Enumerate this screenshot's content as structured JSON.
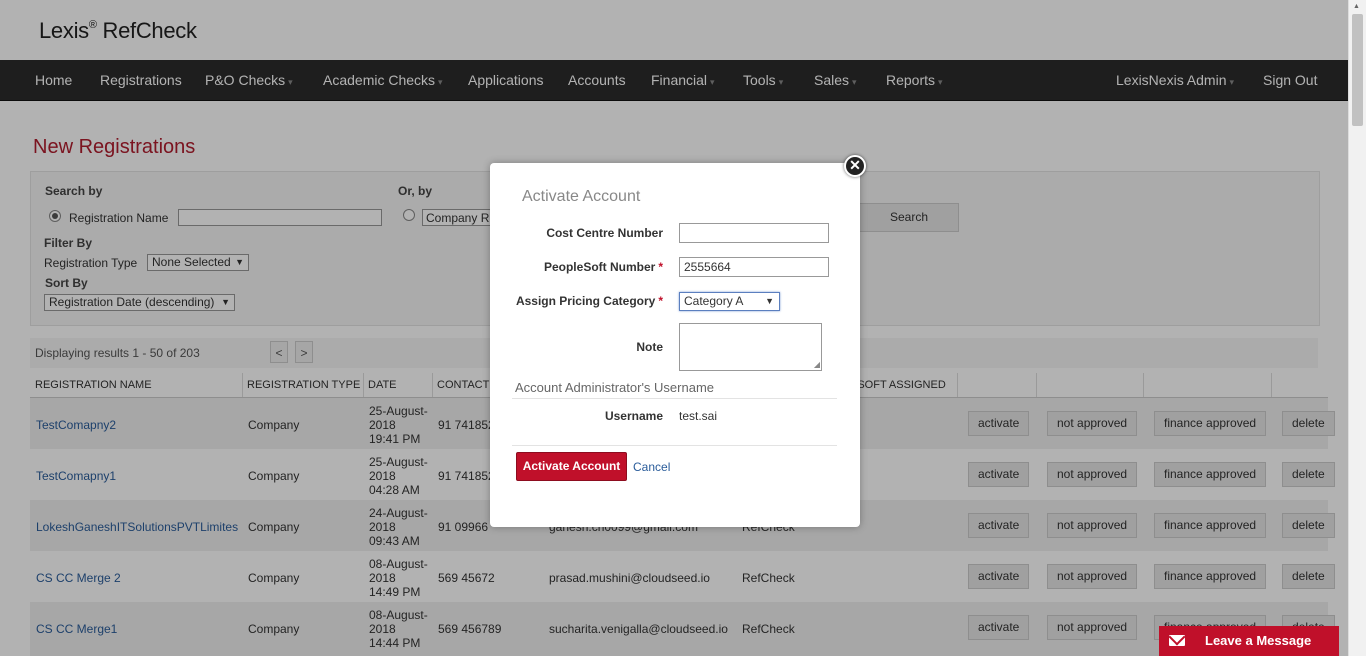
{
  "brand": {
    "name": "Lexis",
    "reg": "®",
    "product": "RefCheck"
  },
  "nav": {
    "items": [
      {
        "label": "Home",
        "caret": ""
      },
      {
        "label": "Registrations",
        "caret": ""
      },
      {
        "label": "P&O Checks",
        "caret": "▾"
      },
      {
        "label": "Academic Checks",
        "caret": "▾"
      },
      {
        "label": "Applications",
        "caret": ""
      },
      {
        "label": "Accounts",
        "caret": ""
      },
      {
        "label": "Financial",
        "caret": "▾"
      },
      {
        "label": "Tools",
        "caret": "▾"
      },
      {
        "label": "Sales",
        "caret": "▾"
      },
      {
        "label": "Reports",
        "caret": "▾"
      }
    ],
    "admin": {
      "label": "LexisNexis Admin",
      "caret": "▾"
    },
    "signout": "Sign Out"
  },
  "page": {
    "title": "New Registrations"
  },
  "search": {
    "search_by": "Search by",
    "radio_reg_name": "Registration Name",
    "or_by": "Or, by",
    "company_field_value": "Company R",
    "search_button": "Search",
    "filter_by": "Filter By",
    "registration_type_label": "Registration Type",
    "registration_type_value": "None Selected",
    "sort_by": "Sort By",
    "sort_value": "Registration Date (descending)"
  },
  "results": {
    "text": "Displaying results 1 - 50 of 203",
    "prev": "<",
    "next": ">"
  },
  "table": {
    "headers": {
      "name": "REGISTRATION NAME",
      "type": "REGISTRATION TYPE",
      "date": "DATE",
      "contact": "CONTACT",
      "ps_assigned": "ESOFT ASSIGNED"
    },
    "rows": [
      {
        "name": "TestComapny2",
        "type": "Company",
        "date1": "25-August-",
        "date2": "2018",
        "date3": "19:41 PM",
        "contact": "91 741852",
        "email": "",
        "source": ""
      },
      {
        "name": "TestComapny1",
        "type": "Company",
        "date1": "25-August-",
        "date2": "2018",
        "date3": "04:28 AM",
        "contact": "91 741852",
        "email": "",
        "source": ""
      },
      {
        "name": "LokeshGaneshITSolutionsPVTLimites",
        "type": "Company",
        "date1": "24-August-",
        "date2": "2018",
        "date3": "09:43 AM",
        "contact": "91 09966",
        "email": "ganesh.ch0099@gmail.com",
        "source": "RefCheck"
      },
      {
        "name": "CS CC Merge 2",
        "type": "Company",
        "date1": "08-August-",
        "date2": "2018",
        "date3": "14:49 PM",
        "contact": "569 45672",
        "email": "prasad.mushini@cloudseed.io",
        "source": "RefCheck"
      },
      {
        "name": "CS CC Merge1",
        "type": "Company",
        "date1": "08-August-",
        "date2": "2018",
        "date3": "14:44 PM",
        "contact": "569 456789",
        "email": "sucharita.venigalla@cloudseed.io",
        "source": "RefCheck"
      }
    ],
    "actions": {
      "activate": "activate",
      "not_approved": "not approved",
      "finance_approved": "finance approved",
      "delete": "delete"
    }
  },
  "modal": {
    "title": "Activate Account",
    "cost_centre_label": "Cost Centre Number",
    "cost_centre_value": "",
    "peoplesoft_label": "PeopleSoft Number",
    "peoplesoft_value": "2555664",
    "pricing_label": "Assign Pricing Category",
    "pricing_value": "Category A",
    "note_label": "Note",
    "admin_section": "Account Administrator's Username",
    "username_label": "Username",
    "username_value": "test.sai",
    "required_marker": "*",
    "activate_button": "Activate Account",
    "cancel_link": "Cancel"
  },
  "chat": {
    "label": "Leave a Message"
  },
  "colors": {
    "brand_red": "#c0102a",
    "nav_bg": "#2c2c2c",
    "link": "#2a5c9a"
  }
}
